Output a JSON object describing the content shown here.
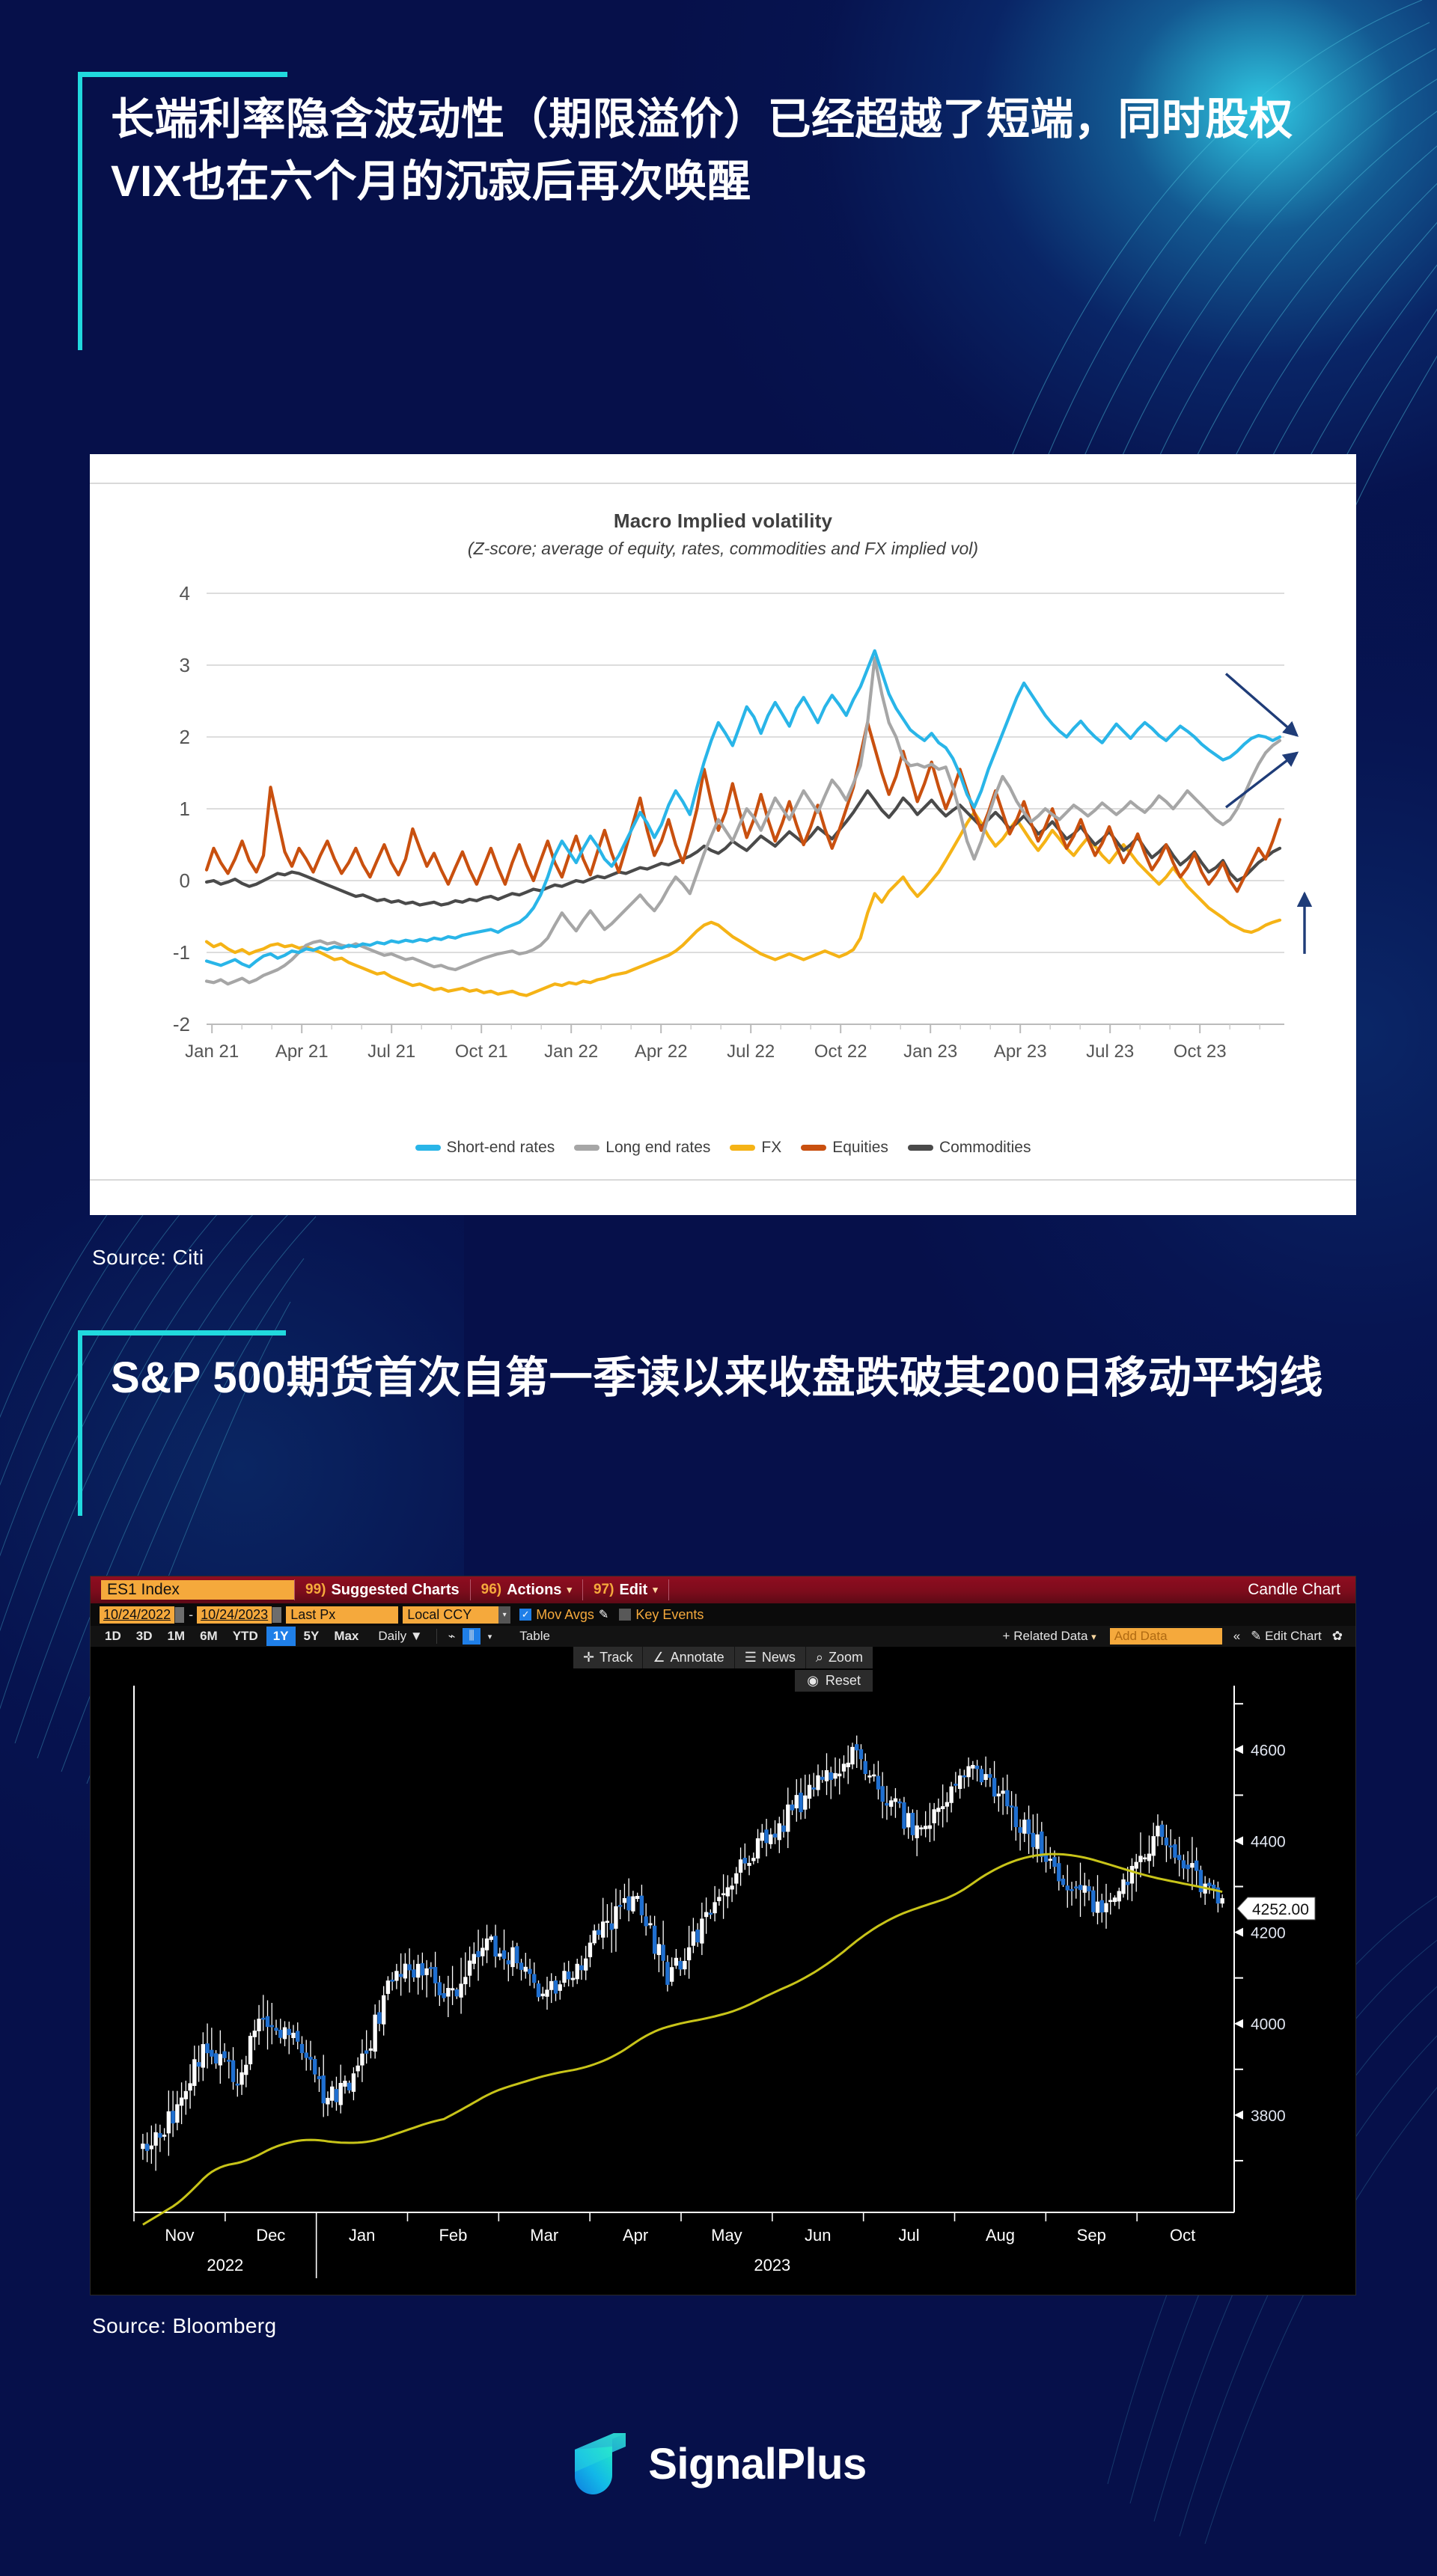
{
  "theme": {
    "background": "#06104a",
    "accent_cyan": "#21d9de",
    "text_white": "#ffffff"
  },
  "headline_1": "长端利率隐含波动性（期限溢价）已经超越了短端，同时股权VIX也在六个月的沉寂后再次唤醒",
  "headline_2": "S&P 500期货首次自第一季读以来收盘跌破其200日移动平均线",
  "source_1": "Source: Citi",
  "source_2": "Source: Bloomberg",
  "brand": {
    "name": "SignalPlus"
  },
  "bloomberg": {
    "header": {
      "ticker": "ES1 Index",
      "suggested_charts_num": "99)",
      "suggested_charts": "Suggested Charts",
      "actions_num": "96)",
      "actions": "Actions",
      "edit_num": "97)",
      "edit": "Edit",
      "chart_type": "Candle Chart",
      "caret": "▾"
    },
    "row2": {
      "date_from": "10/24/2022",
      "dash": "-",
      "date_to": "10/24/2023",
      "price_field": "Last Px",
      "currency": "Local CCY",
      "mov_avgs": "Mov Avgs",
      "mov_avgs_checked": "✓",
      "key_events": "Key Events",
      "key_events_checked": ""
    },
    "row3": {
      "ranges": [
        "1D",
        "3D",
        "1M",
        "6M",
        "YTD",
        "1Y",
        "5Y",
        "Max"
      ],
      "active_range": "1Y",
      "frequency": "Daily",
      "frequency_caret": "▼",
      "table": "Table",
      "related_data": "Related Data",
      "related_data_plus": "+",
      "add_data_placeholder": "Add Data",
      "collapse": "«",
      "edit_chart": "Edit Chart",
      "gear": "✿"
    },
    "tools": {
      "track": "Track",
      "annotate": "Annotate",
      "news": "News",
      "zoom": "Zoom",
      "reset": "Reset"
    }
  },
  "chart_data": [
    {
      "type": "line",
      "title": "Macro Implied volatility",
      "subtitle": "(Z-score; average of equity, rates, commodities and FX implied vol)",
      "xlabel": "",
      "ylabel": "",
      "ylim": [
        -2,
        4
      ],
      "yticks": [
        -2,
        -1,
        0,
        1,
        2,
        3,
        4
      ],
      "grid": true,
      "legend_position": "bottom",
      "tick_labels": [
        "Jan 21",
        "Apr 21",
        "Jul 21",
        "Oct 21",
        "Jan 22",
        "Apr 22",
        "Jul 22",
        "Oct 22",
        "Jan 23",
        "Apr 23",
        "Jul 23",
        "Oct 23"
      ],
      "x_start": "Jan 21",
      "x_end": "Oct 23",
      "annotations": [
        {
          "name": "short-end-rates-down-arrow",
          "direction": "down-right",
          "color": "#1f3c78"
        },
        {
          "name": "long-end-rates-up-arrow",
          "direction": "up-right",
          "color": "#1f3c78"
        },
        {
          "name": "equities-commodities-up-arrow",
          "direction": "up",
          "color": "#1f3c78"
        }
      ],
      "series": [
        {
          "name": "Short-end rates",
          "color": "#29b5e8",
          "values": [
            -1.12,
            -1.15,
            -1.18,
            -1.14,
            -1.1,
            -1.16,
            -1.2,
            -1.12,
            -1.05,
            -1.02,
            -1.08,
            -1.04,
            -0.98,
            -1.0,
            -0.95,
            -0.97,
            -0.93,
            -0.96,
            -0.92,
            -0.94,
            -0.9,
            -0.92,
            -0.88,
            -0.9,
            -0.86,
            -0.88,
            -0.84,
            -0.86,
            -0.83,
            -0.85,
            -0.82,
            -0.84,
            -0.8,
            -0.82,
            -0.78,
            -0.8,
            -0.76,
            -0.74,
            -0.72,
            -0.7,
            -0.68,
            -0.72,
            -0.66,
            -0.62,
            -0.58,
            -0.5,
            -0.38,
            -0.2,
            0.05,
            0.35,
            0.55,
            0.4,
            0.25,
            0.45,
            0.62,
            0.48,
            0.3,
            0.2,
            0.35,
            0.55,
            0.75,
            0.95,
            0.8,
            0.6,
            0.78,
            1.05,
            1.25,
            1.1,
            0.92,
            1.3,
            1.65,
            1.95,
            2.2,
            2.05,
            1.88,
            2.15,
            2.42,
            2.28,
            2.05,
            2.3,
            2.48,
            2.32,
            2.15,
            2.4,
            2.55,
            2.38,
            2.2,
            2.42,
            2.58,
            2.45,
            2.3,
            2.52,
            2.7,
            2.95,
            3.2,
            2.9,
            2.6,
            2.4,
            2.25,
            2.1,
            2.02,
            1.95,
            2.05,
            1.92,
            1.85,
            1.7,
            1.48,
            1.2,
            1.02,
            1.25,
            1.55,
            1.8,
            2.05,
            2.3,
            2.55,
            2.75,
            2.6,
            2.45,
            2.3,
            2.18,
            2.08,
            2.0,
            2.12,
            2.22,
            2.1,
            2.0,
            1.92,
            2.05,
            2.18,
            2.08,
            1.98,
            2.1,
            2.2,
            2.12,
            2.02,
            1.95,
            2.05,
            2.15,
            2.08,
            2.0,
            1.9,
            1.82,
            1.75,
            1.68,
            1.72,
            1.8,
            1.9,
            1.98,
            2.02,
            2.0,
            1.95,
            2.0
          ]
        },
        {
          "name": "Long end rates",
          "color": "#a6a6a6",
          "values": [
            -1.4,
            -1.42,
            -1.38,
            -1.44,
            -1.4,
            -1.36,
            -1.42,
            -1.38,
            -1.32,
            -1.28,
            -1.24,
            -1.18,
            -1.1,
            -1.0,
            -0.9,
            -0.86,
            -0.84,
            -0.88,
            -0.86,
            -0.9,
            -0.92,
            -0.88,
            -0.92,
            -0.96,
            -1.0,
            -1.04,
            -1.02,
            -1.06,
            -1.1,
            -1.08,
            -1.12,
            -1.16,
            -1.2,
            -1.18,
            -1.22,
            -1.24,
            -1.2,
            -1.16,
            -1.12,
            -1.08,
            -1.05,
            -1.02,
            -1.0,
            -0.98,
            -1.02,
            -1.0,
            -0.96,
            -0.9,
            -0.8,
            -0.62,
            -0.45,
            -0.58,
            -0.7,
            -0.55,
            -0.42,
            -0.55,
            -0.68,
            -0.6,
            -0.5,
            -0.4,
            -0.3,
            -0.2,
            -0.32,
            -0.42,
            -0.28,
            -0.1,
            0.05,
            -0.05,
            -0.18,
            0.1,
            0.38,
            0.62,
            0.85,
            0.7,
            0.55,
            0.78,
            1.0,
            0.88,
            0.7,
            0.92,
            1.15,
            1.0,
            0.85,
            1.05,
            1.25,
            1.1,
            0.95,
            1.18,
            1.4,
            1.28,
            1.12,
            1.35,
            1.6,
            2.2,
            3.1,
            2.6,
            2.2,
            2.0,
            1.7,
            1.6,
            1.62,
            1.58,
            1.62,
            1.55,
            1.58,
            1.3,
            0.95,
            0.55,
            0.3,
            0.55,
            0.9,
            1.2,
            1.45,
            1.3,
            1.1,
            0.95,
            0.82,
            0.9,
            1.0,
            0.92,
            0.85,
            0.95,
            1.05,
            0.98,
            0.9,
            0.98,
            1.08,
            1.0,
            0.92,
            1.0,
            1.1,
            1.02,
            0.95,
            1.05,
            1.18,
            1.1,
            1.0,
            1.12,
            1.25,
            1.15,
            1.05,
            0.95,
            0.85,
            0.78,
            0.85,
            1.0,
            1.2,
            1.42,
            1.62,
            1.78,
            1.88,
            1.95
          ]
        },
        {
          "name": "FX",
          "color": "#f5b316",
          "values": [
            -0.85,
            -0.92,
            -0.88,
            -0.95,
            -1.0,
            -0.96,
            -1.02,
            -0.98,
            -0.95,
            -0.9,
            -0.88,
            -0.92,
            -0.9,
            -0.94,
            -0.92,
            -0.96,
            -1.0,
            -1.05,
            -1.1,
            -1.08,
            -1.14,
            -1.18,
            -1.22,
            -1.26,
            -1.3,
            -1.28,
            -1.34,
            -1.38,
            -1.42,
            -1.46,
            -1.44,
            -1.48,
            -1.52,
            -1.5,
            -1.54,
            -1.52,
            -1.5,
            -1.54,
            -1.52,
            -1.56,
            -1.54,
            -1.58,
            -1.56,
            -1.54,
            -1.58,
            -1.6,
            -1.56,
            -1.52,
            -1.48,
            -1.44,
            -1.46,
            -1.42,
            -1.44,
            -1.4,
            -1.42,
            -1.38,
            -1.36,
            -1.32,
            -1.3,
            -1.28,
            -1.24,
            -1.2,
            -1.16,
            -1.12,
            -1.08,
            -1.04,
            -0.98,
            -0.9,
            -0.8,
            -0.7,
            -0.62,
            -0.58,
            -0.62,
            -0.7,
            -0.78,
            -0.84,
            -0.9,
            -0.96,
            -1.02,
            -1.06,
            -1.1,
            -1.06,
            -1.02,
            -1.06,
            -1.1,
            -1.06,
            -1.02,
            -0.98,
            -1.02,
            -1.06,
            -1.02,
            -0.96,
            -0.8,
            -0.45,
            -0.18,
            -0.3,
            -0.15,
            -0.05,
            0.05,
            -0.1,
            -0.22,
            -0.12,
            0.0,
            0.12,
            0.28,
            0.45,
            0.62,
            0.8,
            0.95,
            0.8,
            0.62,
            0.48,
            0.58,
            0.72,
            0.85,
            0.7,
            0.55,
            0.42,
            0.55,
            0.7,
            0.58,
            0.45,
            0.35,
            0.48,
            0.6,
            0.48,
            0.35,
            0.25,
            0.38,
            0.5,
            0.38,
            0.25,
            0.15,
            0.05,
            -0.05,
            0.05,
            0.18,
            0.05,
            -0.08,
            -0.18,
            -0.28,
            -0.38,
            -0.45,
            -0.52,
            -0.6,
            -0.65,
            -0.7,
            -0.72,
            -0.68,
            -0.62,
            -0.58,
            -0.55
          ]
        },
        {
          "name": "Equities",
          "color": "#c9500f",
          "values": [
            0.15,
            0.45,
            0.25,
            0.1,
            0.3,
            0.55,
            0.28,
            0.12,
            0.35,
            1.3,
            0.85,
            0.4,
            0.2,
            0.45,
            0.3,
            0.12,
            0.35,
            0.55,
            0.3,
            0.1,
            0.25,
            0.45,
            0.22,
            0.05,
            0.28,
            0.5,
            0.25,
            0.08,
            0.3,
            0.72,
            0.45,
            0.2,
            0.38,
            0.15,
            -0.05,
            0.18,
            0.4,
            0.15,
            -0.05,
            0.2,
            0.45,
            0.18,
            -0.05,
            0.25,
            0.5,
            0.22,
            0.0,
            0.28,
            0.55,
            0.25,
            0.05,
            0.35,
            0.62,
            0.3,
            0.08,
            0.4,
            0.7,
            0.38,
            0.12,
            0.45,
            0.8,
            1.15,
            0.7,
            0.35,
            0.55,
            0.85,
            0.5,
            0.25,
            0.6,
            1.0,
            1.55,
            1.1,
            0.7,
            0.95,
            1.35,
            0.95,
            0.6,
            0.85,
            1.2,
            0.85,
            0.55,
            0.8,
            1.1,
            0.78,
            0.5,
            0.75,
            1.05,
            0.72,
            0.45,
            0.7,
            1.0,
            1.3,
            1.75,
            2.2,
            1.85,
            1.5,
            1.2,
            1.45,
            1.8,
            1.45,
            1.1,
            1.35,
            1.65,
            1.3,
            1.0,
            1.25,
            1.55,
            1.25,
            0.95,
            0.7,
            0.95,
            1.25,
            0.95,
            0.65,
            0.85,
            1.1,
            0.8,
            0.55,
            0.75,
            1.0,
            0.7,
            0.45,
            0.62,
            0.85,
            0.58,
            0.35,
            0.52,
            0.75,
            0.48,
            0.25,
            0.42,
            0.65,
            0.38,
            0.15,
            0.3,
            0.5,
            0.25,
            0.05,
            0.18,
            0.38,
            0.12,
            -0.05,
            0.08,
            0.25,
            0.0,
            -0.15,
            0.05,
            0.25,
            0.45,
            0.3,
            0.55,
            0.85
          ]
        },
        {
          "name": "Commodities",
          "color": "#4a4a4a",
          "values": [
            -0.02,
            0.0,
            -0.05,
            -0.02,
            0.02,
            -0.04,
            -0.08,
            -0.05,
            0.0,
            0.05,
            0.1,
            0.08,
            0.12,
            0.1,
            0.06,
            0.02,
            -0.02,
            -0.06,
            -0.1,
            -0.14,
            -0.18,
            -0.22,
            -0.2,
            -0.24,
            -0.28,
            -0.26,
            -0.3,
            -0.28,
            -0.32,
            -0.3,
            -0.34,
            -0.32,
            -0.3,
            -0.34,
            -0.32,
            -0.28,
            -0.3,
            -0.26,
            -0.28,
            -0.24,
            -0.22,
            -0.26,
            -0.22,
            -0.18,
            -0.2,
            -0.16,
            -0.12,
            -0.14,
            -0.1,
            -0.06,
            -0.08,
            -0.04,
            0.0,
            -0.02,
            0.02,
            0.06,
            0.04,
            0.08,
            0.12,
            0.1,
            0.14,
            0.18,
            0.16,
            0.2,
            0.24,
            0.22,
            0.26,
            0.3,
            0.34,
            0.4,
            0.48,
            0.42,
            0.38,
            0.45,
            0.55,
            0.48,
            0.42,
            0.52,
            0.62,
            0.55,
            0.48,
            0.58,
            0.68,
            0.6,
            0.52,
            0.62,
            0.74,
            0.66,
            0.58,
            0.7,
            0.82,
            0.95,
            1.1,
            1.25,
            1.12,
            0.98,
            0.88,
            1.0,
            1.15,
            1.05,
            0.92,
            1.02,
            1.12,
            1.0,
            0.9,
            0.98,
            1.05,
            0.95,
            0.85,
            0.75,
            0.85,
            0.95,
            0.85,
            0.72,
            0.8,
            0.9,
            0.78,
            0.65,
            0.72,
            0.82,
            0.7,
            0.58,
            0.65,
            0.75,
            0.62,
            0.5,
            0.58,
            0.68,
            0.55,
            0.42,
            0.5,
            0.6,
            0.45,
            0.32,
            0.4,
            0.5,
            0.35,
            0.22,
            0.3,
            0.4,
            0.25,
            0.12,
            0.18,
            0.28,
            0.1,
            0.0,
            0.05,
            0.15,
            0.25,
            0.32,
            0.4,
            0.45
          ]
        }
      ]
    },
    {
      "type": "candlestick",
      "title": "ES1 Index — Candle Chart",
      "xlabel": "",
      "ylabel": "",
      "ylim": [
        3600,
        4720
      ],
      "yticks": [
        3800,
        4000,
        4200,
        4400,
        4600
      ],
      "grid": false,
      "tick_labels": [
        "Nov",
        "Dec",
        "Jan",
        "Feb",
        "Mar",
        "Apr",
        "May",
        "Jun",
        "Jul",
        "Aug",
        "Sep",
        "Oct"
      ],
      "year_labels": [
        "2022",
        "2023"
      ],
      "last_price": "4252.00",
      "last_price_value": 4252.0,
      "overlay": {
        "name": "200-day moving average",
        "color": "#c8c419"
      },
      "candle_up_color": "#ffffff",
      "candle_down_color": "#1f6fd0",
      "series_note": "Daily OHLC, 10/24/2022 - 10/24/2023"
    }
  ],
  "legend_1": [
    {
      "label": "Short-end rates",
      "color": "#29b5e8"
    },
    {
      "label": "Long end rates",
      "color": "#a6a6a6"
    },
    {
      "label": "FX",
      "color": "#f5b316"
    },
    {
      "label": "Equities",
      "color": "#c9500f"
    },
    {
      "label": "Commodities",
      "color": "#4a4a4a"
    }
  ]
}
